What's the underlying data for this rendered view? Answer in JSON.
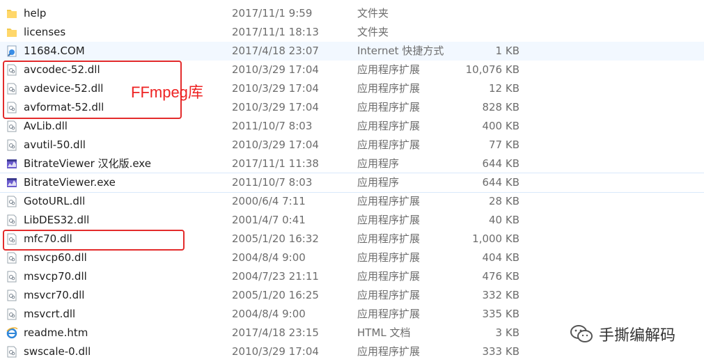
{
  "files": [
    {
      "name": "help",
      "date": "2017/11/1 9:59",
      "type": "文件夹",
      "size": "",
      "icon": "folder-icon"
    },
    {
      "name": "licenses",
      "date": "2017/11/1 18:13",
      "type": "文件夹",
      "size": "",
      "icon": "folder-icon"
    },
    {
      "name": "11684.COM",
      "date": "2017/4/18 23:07",
      "type": "Internet 快捷方式",
      "size": "1 KB",
      "icon": "internet-shortcut-icon"
    },
    {
      "name": "avcodec-52.dll",
      "date": "2010/3/29 17:04",
      "type": "应用程序扩展",
      "size": "10,076 KB",
      "icon": "dll-icon"
    },
    {
      "name": "avdevice-52.dll",
      "date": "2010/3/29 17:04",
      "type": "应用程序扩展",
      "size": "12 KB",
      "icon": "dll-icon"
    },
    {
      "name": "avformat-52.dll",
      "date": "2010/3/29 17:04",
      "type": "应用程序扩展",
      "size": "828 KB",
      "icon": "dll-icon"
    },
    {
      "name": "AvLib.dll",
      "date": "2011/10/7 8:03",
      "type": "应用程序扩展",
      "size": "400 KB",
      "icon": "dll-icon"
    },
    {
      "name": "avutil-50.dll",
      "date": "2010/3/29 17:04",
      "type": "应用程序扩展",
      "size": "77 KB",
      "icon": "dll-icon"
    },
    {
      "name": "BitrateViewer 汉化版.exe",
      "date": "2017/11/1 11:38",
      "type": "应用程序",
      "size": "644 KB",
      "icon": "exe-icon"
    },
    {
      "name": "BitrateViewer.exe",
      "date": "2011/10/7 8:03",
      "type": "应用程序",
      "size": "644 KB",
      "icon": "exe-icon"
    },
    {
      "name": "GotoURL.dll",
      "date": "2000/6/4 7:11",
      "type": "应用程序扩展",
      "size": "28 KB",
      "icon": "dll-icon"
    },
    {
      "name": "LibDES32.dll",
      "date": "2001/4/7 0:41",
      "type": "应用程序扩展",
      "size": "40 KB",
      "icon": "dll-icon"
    },
    {
      "name": "mfc70.dll",
      "date": "2005/1/20 16:32",
      "type": "应用程序扩展",
      "size": "1,000 KB",
      "icon": "dll-icon"
    },
    {
      "name": "msvcp60.dll",
      "date": "2004/8/4 9:00",
      "type": "应用程序扩展",
      "size": "404 KB",
      "icon": "dll-icon"
    },
    {
      "name": "msvcp70.dll",
      "date": "2004/7/23 21:11",
      "type": "应用程序扩展",
      "size": "476 KB",
      "icon": "dll-icon"
    },
    {
      "name": "msvcr70.dll",
      "date": "2005/1/20 16:25",
      "type": "应用程序扩展",
      "size": "332 KB",
      "icon": "dll-icon"
    },
    {
      "name": "msvcrt.dll",
      "date": "2004/8/4 9:00",
      "type": "应用程序扩展",
      "size": "335 KB",
      "icon": "dll-icon"
    },
    {
      "name": "readme.htm",
      "date": "2017/4/18 23:15",
      "type": "HTML 文档",
      "size": "3 KB",
      "icon": "ie-html-icon"
    },
    {
      "name": "swscale-0.dll",
      "date": "2010/3/29 17:04",
      "type": "应用程序扩展",
      "size": "333 KB",
      "icon": "dll-icon"
    }
  ],
  "annotation": {
    "label": "FFmpeg库",
    "color": "#e32b2b"
  },
  "watermark": {
    "text": "手撕编解码",
    "icon": "wechat-icon"
  }
}
